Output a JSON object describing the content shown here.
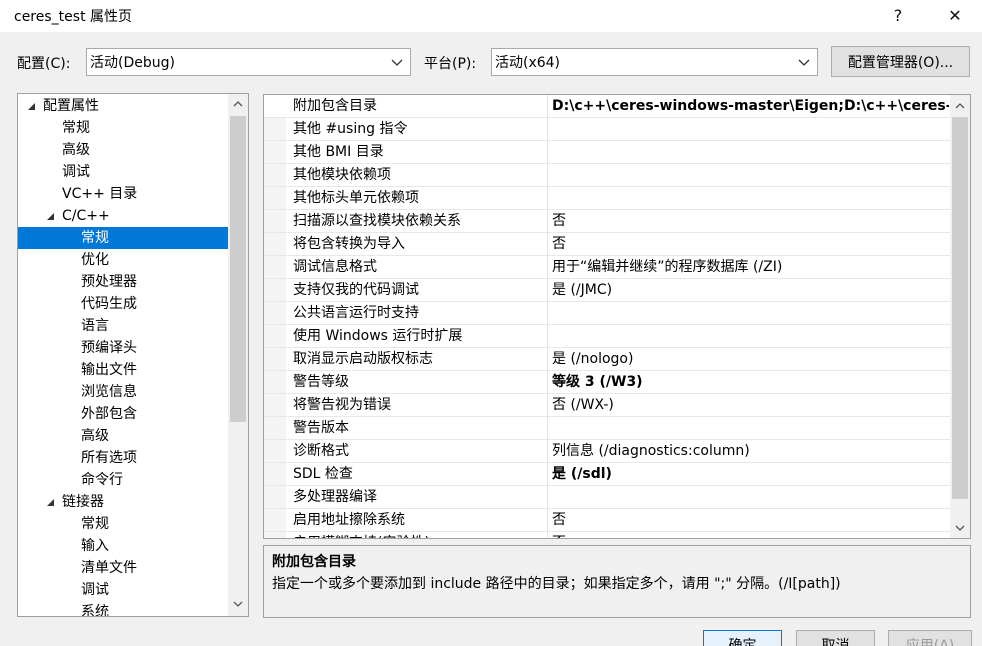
{
  "window": {
    "title": "ceres_test 属性页",
    "help_label": "?",
    "close_label": "✕"
  },
  "config_row": {
    "config_label": "配置(C):",
    "config_value": "活动(Debug)",
    "platform_label": "平台(P):",
    "platform_value": "活动(x64)",
    "manager_button": "配置管理器(O)..."
  },
  "tree": {
    "items": [
      {
        "label": "配置属性"
      },
      {
        "label": "常规"
      },
      {
        "label": "高级"
      },
      {
        "label": "调试"
      },
      {
        "label": "VC++ 目录"
      },
      {
        "label": "C/C++"
      },
      {
        "label": "常规"
      },
      {
        "label": "优化"
      },
      {
        "label": "预处理器"
      },
      {
        "label": "代码生成"
      },
      {
        "label": "语言"
      },
      {
        "label": "预编译头"
      },
      {
        "label": "输出文件"
      },
      {
        "label": "浏览信息"
      },
      {
        "label": "外部包含"
      },
      {
        "label": "高级"
      },
      {
        "label": "所有选项"
      },
      {
        "label": "命令行"
      },
      {
        "label": "链接器"
      },
      {
        "label": "常规"
      },
      {
        "label": "输入"
      },
      {
        "label": "清单文件"
      },
      {
        "label": "调试"
      },
      {
        "label": "系统"
      }
    ]
  },
  "grid": {
    "rows": [
      {
        "name": "附加包含目录",
        "value": "D:\\c++\\ceres-windows-master\\Eigen;D:\\c++\\ceres-w",
        "bold": true
      },
      {
        "name": "其他 #using 指令",
        "value": ""
      },
      {
        "name": "其他 BMI 目录",
        "value": ""
      },
      {
        "name": "其他模块依赖项",
        "value": ""
      },
      {
        "name": "其他标头单元依赖项",
        "value": ""
      },
      {
        "name": "扫描源以查找模块依赖关系",
        "value": "否"
      },
      {
        "name": "将包含转换为导入",
        "value": "否"
      },
      {
        "name": "调试信息格式",
        "value": "用于“编辑并继续”的程序数据库 (/ZI)"
      },
      {
        "name": "支持仅我的代码调试",
        "value": "是 (/JMC)"
      },
      {
        "name": "公共语言运行时支持",
        "value": ""
      },
      {
        "name": "使用 Windows 运行时扩展",
        "value": ""
      },
      {
        "name": "取消显示启动版权标志",
        "value": "是 (/nologo)"
      },
      {
        "name": "警告等级",
        "value": "等级 3 (/W3)",
        "bold": true
      },
      {
        "name": "将警告视为错误",
        "value": "否 (/WX-)"
      },
      {
        "name": "警告版本",
        "value": ""
      },
      {
        "name": "诊断格式",
        "value": "列信息 (/diagnostics:column)"
      },
      {
        "name": "SDL 检查",
        "value": "是 (/sdl)",
        "bold": true
      },
      {
        "name": "多处理器编译",
        "value": ""
      },
      {
        "name": "启用地址擦除系统",
        "value": "否"
      },
      {
        "name": "启用模糊支持(实验性)",
        "value": "否"
      }
    ]
  },
  "description": {
    "title": "附加包含目录",
    "text": "指定一个或多个要添加到 include 路径中的目录；如果指定多个，请用 \";\" 分隔。(/I[path])"
  },
  "footer": {
    "ok": "确定",
    "cancel": "取消",
    "apply": "应用(A)"
  },
  "colors": {
    "selection": "#0078d7",
    "window_bg": "#f0f0f0"
  }
}
